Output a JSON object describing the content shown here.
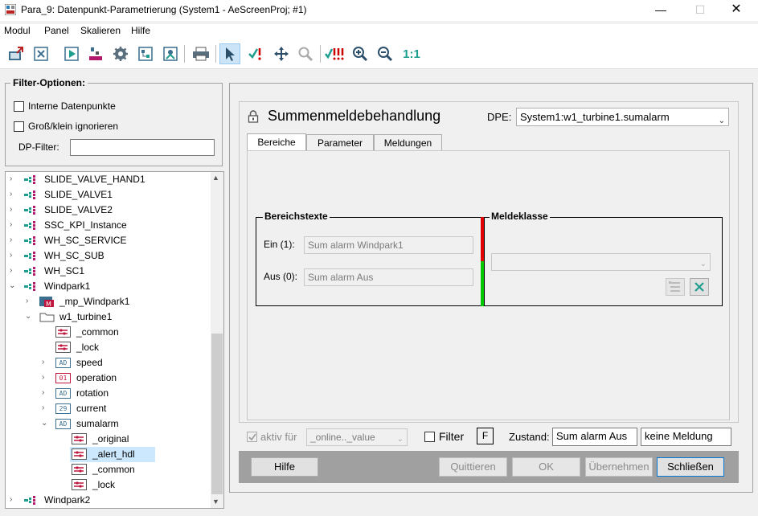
{
  "window": {
    "title": "Para_9: Datenpunkt-Parametrierung (System1 - AeScreenProj; #1)",
    "minimize": "—",
    "maximize": "☐",
    "close": "✕"
  },
  "menu": [
    "Modul",
    "Panel",
    "Skalieren",
    "Hilfe"
  ],
  "toolbar": {
    "zoom_reset_label": "1:1",
    "icons": [
      "export-icon",
      "close-panel-icon",
      "play-icon",
      "datapoint-icon",
      "gear-icon",
      "structure-icon",
      "structure-alt-icon",
      "print-icon",
      "pointer-icon",
      "check-alert-icon",
      "move-icon",
      "search-icon",
      "check-alerts-icon",
      "zoom-in-icon",
      "zoom-out-icon"
    ]
  },
  "filter": {
    "title": "Filter-Optionen:",
    "internal_label": "Interne Datenpunkte",
    "case_label": "Groß/klein ignorieren",
    "dp_filter_label": "DP-Filter:",
    "dp_filter_value": ""
  },
  "tree": {
    "items": [
      {
        "label": "SLIDE_VALVE_HAND1"
      },
      {
        "label": "SLIDE_VALVE1"
      },
      {
        "label": "SLIDE_VALVE2"
      },
      {
        "label": "SSC_KPI_Instance"
      },
      {
        "label": "WH_SC_SERVICE"
      },
      {
        "label": "WH_SC_SUB"
      },
      {
        "label": "WH_SC1"
      },
      {
        "label": "Windpark1"
      },
      {
        "label": "_mp_Windpark1"
      },
      {
        "label": "w1_turbine1"
      },
      {
        "label": "_common"
      },
      {
        "label": "_lock"
      },
      {
        "label": "speed",
        "badge": "AD"
      },
      {
        "label": "operation",
        "badge": "01"
      },
      {
        "label": "rotation",
        "badge": "AD"
      },
      {
        "label": "current",
        "badge": "29"
      },
      {
        "label": "sumalarm",
        "badge": "AD"
      },
      {
        "label": "_original"
      },
      {
        "label": "_alert_hdl"
      },
      {
        "label": "_common"
      },
      {
        "label": "_lock"
      },
      {
        "label": "Windpark2"
      }
    ]
  },
  "panel": {
    "title": "Summenmeldebehandlung",
    "dpe_label": "DPE:",
    "dpe_value": "System1:w1_turbine1.sumalarm",
    "tabs": [
      "Bereiche",
      "Parameter",
      "Meldungen"
    ],
    "bereichstexte_title": "Bereichstexte",
    "ein_label": "Ein (1):",
    "ein_value": "Sum alarm Windpark1",
    "aus_label": "Aus (0):",
    "aus_value": "Sum alarm Aus",
    "meldeklasse_title": "Meldeklasse",
    "meldeklasse_value": "",
    "status_colors": {
      "on": "#e00000",
      "off": "#00c800"
    }
  },
  "footer": {
    "aktiv_label": "aktiv für",
    "aktiv_value": "_online.._value",
    "filter_label": "Filter",
    "f_button": "F",
    "zustand_label": "Zustand:",
    "zustand_value": "Sum alarm Aus",
    "meldung_value": "keine Meldung"
  },
  "buttons": {
    "hilfe": "Hilfe",
    "quittieren": "Quittieren",
    "ok": "OK",
    "uebernehmen": "Übernehmen",
    "schliessen": "Schließen"
  }
}
